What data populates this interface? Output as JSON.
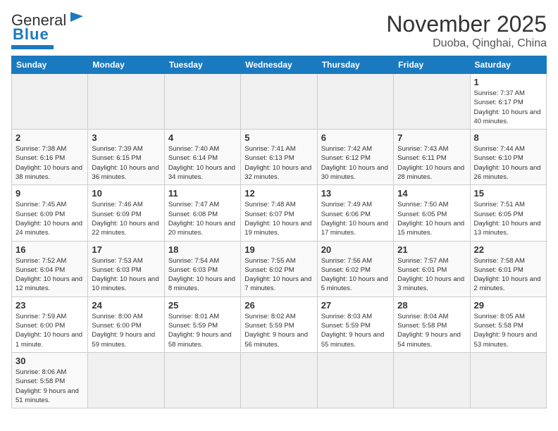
{
  "header": {
    "logo_general": "General",
    "logo_blue": "Blue",
    "month_title": "November 2025",
    "location": "Duoba, Qinghai, China"
  },
  "weekdays": [
    "Sunday",
    "Monday",
    "Tuesday",
    "Wednesday",
    "Thursday",
    "Friday",
    "Saturday"
  ],
  "weeks": [
    [
      {
        "day": "",
        "empty": true
      },
      {
        "day": "",
        "empty": true
      },
      {
        "day": "",
        "empty": true
      },
      {
        "day": "",
        "empty": true
      },
      {
        "day": "",
        "empty": true
      },
      {
        "day": "",
        "empty": true
      },
      {
        "day": "1",
        "sunrise": "Sunrise: 7:37 AM",
        "sunset": "Sunset: 6:17 PM",
        "daylight": "Daylight: 10 hours and 40 minutes."
      }
    ],
    [
      {
        "day": "2",
        "sunrise": "Sunrise: 7:38 AM",
        "sunset": "Sunset: 6:16 PM",
        "daylight": "Daylight: 10 hours and 38 minutes."
      },
      {
        "day": "3",
        "sunrise": "Sunrise: 7:39 AM",
        "sunset": "Sunset: 6:15 PM",
        "daylight": "Daylight: 10 hours and 36 minutes."
      },
      {
        "day": "4",
        "sunrise": "Sunrise: 7:40 AM",
        "sunset": "Sunset: 6:14 PM",
        "daylight": "Daylight: 10 hours and 34 minutes."
      },
      {
        "day": "5",
        "sunrise": "Sunrise: 7:41 AM",
        "sunset": "Sunset: 6:13 PM",
        "daylight": "Daylight: 10 hours and 32 minutes."
      },
      {
        "day": "6",
        "sunrise": "Sunrise: 7:42 AM",
        "sunset": "Sunset: 6:12 PM",
        "daylight": "Daylight: 10 hours and 30 minutes."
      },
      {
        "day": "7",
        "sunrise": "Sunrise: 7:43 AM",
        "sunset": "Sunset: 6:11 PM",
        "daylight": "Daylight: 10 hours and 28 minutes."
      },
      {
        "day": "8",
        "sunrise": "Sunrise: 7:44 AM",
        "sunset": "Sunset: 6:10 PM",
        "daylight": "Daylight: 10 hours and 26 minutes."
      }
    ],
    [
      {
        "day": "9",
        "sunrise": "Sunrise: 7:45 AM",
        "sunset": "Sunset: 6:09 PM",
        "daylight": "Daylight: 10 hours and 24 minutes."
      },
      {
        "day": "10",
        "sunrise": "Sunrise: 7:46 AM",
        "sunset": "Sunset: 6:09 PM",
        "daylight": "Daylight: 10 hours and 22 minutes."
      },
      {
        "day": "11",
        "sunrise": "Sunrise: 7:47 AM",
        "sunset": "Sunset: 6:08 PM",
        "daylight": "Daylight: 10 hours and 20 minutes."
      },
      {
        "day": "12",
        "sunrise": "Sunrise: 7:48 AM",
        "sunset": "Sunset: 6:07 PM",
        "daylight": "Daylight: 10 hours and 19 minutes."
      },
      {
        "day": "13",
        "sunrise": "Sunrise: 7:49 AM",
        "sunset": "Sunset: 6:06 PM",
        "daylight": "Daylight: 10 hours and 17 minutes."
      },
      {
        "day": "14",
        "sunrise": "Sunrise: 7:50 AM",
        "sunset": "Sunset: 6:05 PM",
        "daylight": "Daylight: 10 hours and 15 minutes."
      },
      {
        "day": "15",
        "sunrise": "Sunrise: 7:51 AM",
        "sunset": "Sunset: 6:05 PM",
        "daylight": "Daylight: 10 hours and 13 minutes."
      }
    ],
    [
      {
        "day": "16",
        "sunrise": "Sunrise: 7:52 AM",
        "sunset": "Sunset: 6:04 PM",
        "daylight": "Daylight: 10 hours and 12 minutes."
      },
      {
        "day": "17",
        "sunrise": "Sunrise: 7:53 AM",
        "sunset": "Sunset: 6:03 PM",
        "daylight": "Daylight: 10 hours and 10 minutes."
      },
      {
        "day": "18",
        "sunrise": "Sunrise: 7:54 AM",
        "sunset": "Sunset: 6:03 PM",
        "daylight": "Daylight: 10 hours and 8 minutes."
      },
      {
        "day": "19",
        "sunrise": "Sunrise: 7:55 AM",
        "sunset": "Sunset: 6:02 PM",
        "daylight": "Daylight: 10 hours and 7 minutes."
      },
      {
        "day": "20",
        "sunrise": "Sunrise: 7:56 AM",
        "sunset": "Sunset: 6:02 PM",
        "daylight": "Daylight: 10 hours and 5 minutes."
      },
      {
        "day": "21",
        "sunrise": "Sunrise: 7:57 AM",
        "sunset": "Sunset: 6:01 PM",
        "daylight": "Daylight: 10 hours and 3 minutes."
      },
      {
        "day": "22",
        "sunrise": "Sunrise: 7:58 AM",
        "sunset": "Sunset: 6:01 PM",
        "daylight": "Daylight: 10 hours and 2 minutes."
      }
    ],
    [
      {
        "day": "23",
        "sunrise": "Sunrise: 7:59 AM",
        "sunset": "Sunset: 6:00 PM",
        "daylight": "Daylight: 10 hours and 1 minute."
      },
      {
        "day": "24",
        "sunrise": "Sunrise: 8:00 AM",
        "sunset": "Sunset: 6:00 PM",
        "daylight": "Daylight: 9 hours and 59 minutes."
      },
      {
        "day": "25",
        "sunrise": "Sunrise: 8:01 AM",
        "sunset": "Sunset: 5:59 PM",
        "daylight": "Daylight: 9 hours and 58 minutes."
      },
      {
        "day": "26",
        "sunrise": "Sunrise: 8:02 AM",
        "sunset": "Sunset: 5:59 PM",
        "daylight": "Daylight: 9 hours and 56 minutes."
      },
      {
        "day": "27",
        "sunrise": "Sunrise: 8:03 AM",
        "sunset": "Sunset: 5:59 PM",
        "daylight": "Daylight: 9 hours and 55 minutes."
      },
      {
        "day": "28",
        "sunrise": "Sunrise: 8:04 AM",
        "sunset": "Sunset: 5:58 PM",
        "daylight": "Daylight: 9 hours and 54 minutes."
      },
      {
        "day": "29",
        "sunrise": "Sunrise: 8:05 AM",
        "sunset": "Sunset: 5:58 PM",
        "daylight": "Daylight: 9 hours and 53 minutes."
      }
    ],
    [
      {
        "day": "30",
        "sunrise": "Sunrise: 8:06 AM",
        "sunset": "Sunset: 5:58 PM",
        "daylight": "Daylight: 9 hours and 51 minutes."
      },
      {
        "day": "",
        "empty": true
      },
      {
        "day": "",
        "empty": true
      },
      {
        "day": "",
        "empty": true
      },
      {
        "day": "",
        "empty": true
      },
      {
        "day": "",
        "empty": true
      },
      {
        "day": "",
        "empty": true
      }
    ]
  ]
}
